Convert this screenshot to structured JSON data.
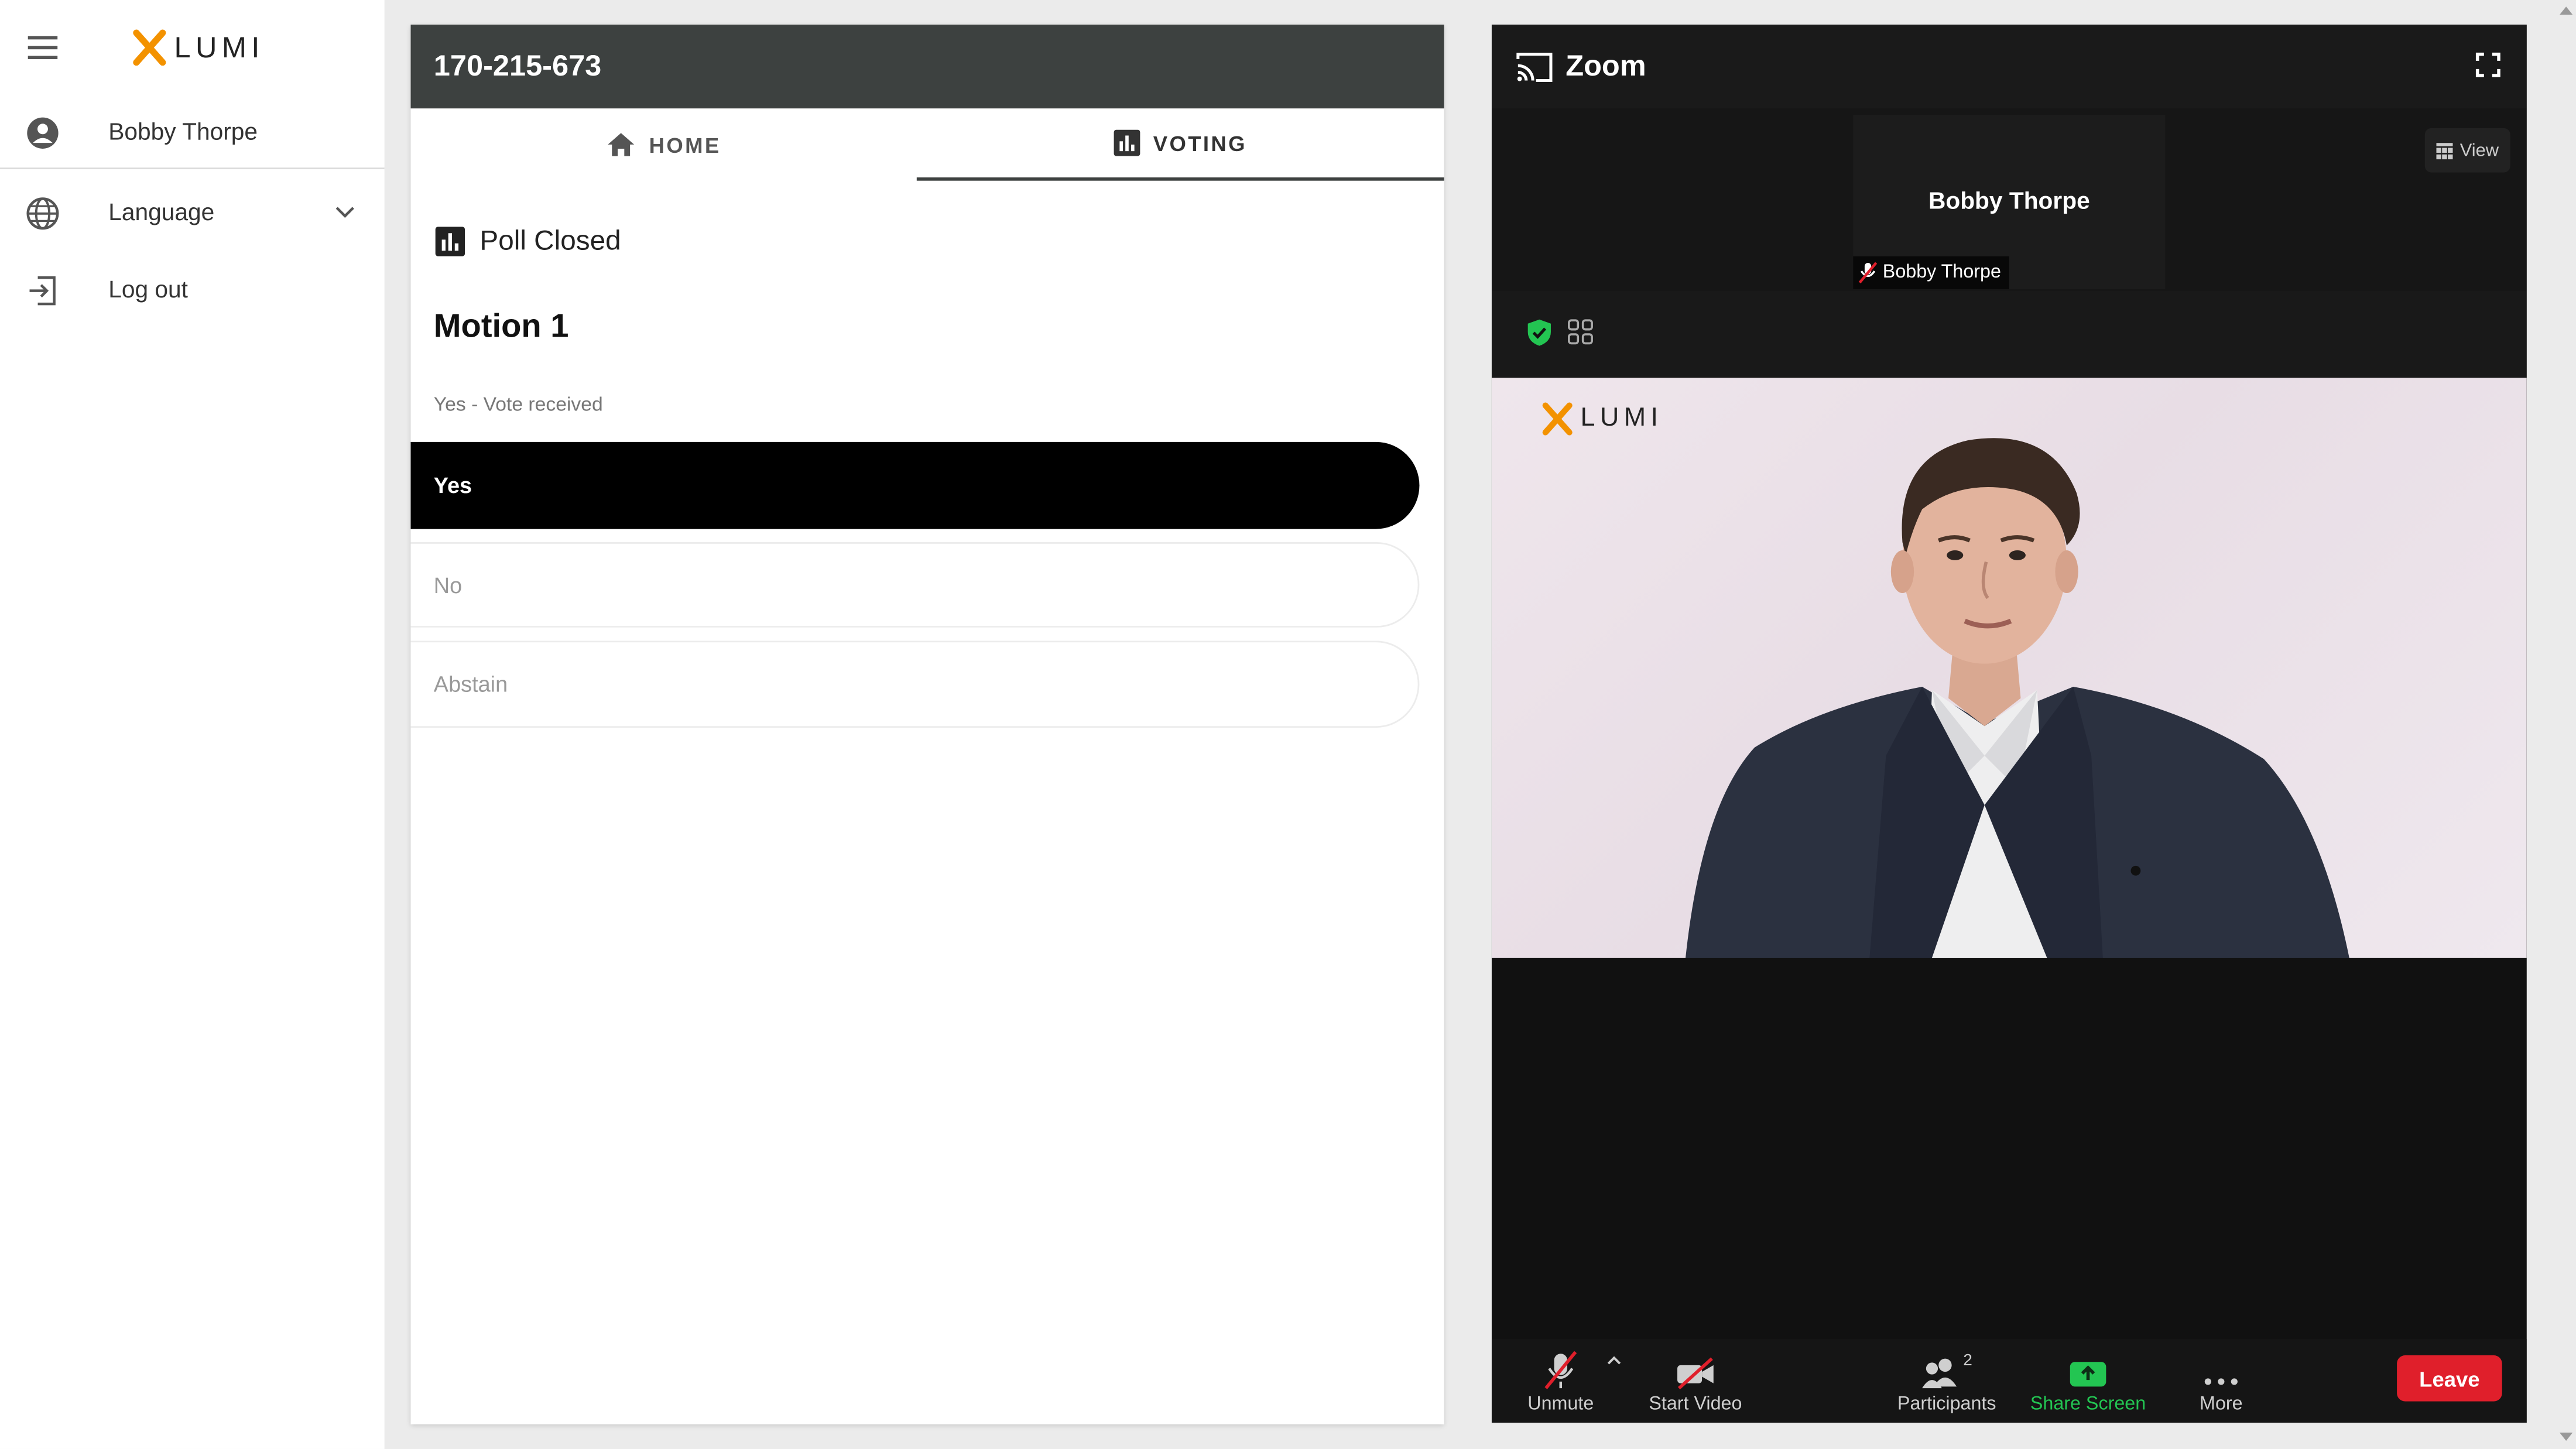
{
  "sidebar": {
    "logo_text": "LUMI",
    "user_name": "Bobby Thorpe",
    "language_label": "Language",
    "logout_label": "Log out"
  },
  "voting": {
    "meeting_id": "170-215-673",
    "tabs": [
      {
        "label": "HOME",
        "icon": "home-icon"
      },
      {
        "label": "VOTING",
        "icon": "bar-chart-icon",
        "active": true
      }
    ],
    "poll_status": "Poll Closed",
    "motion_title": "Motion 1",
    "vote_status": "Yes - Vote received",
    "options": [
      {
        "label": "Yes",
        "selected": true
      },
      {
        "label": "No",
        "selected": false
      },
      {
        "label": "Abstain",
        "selected": false
      }
    ]
  },
  "zoom": {
    "title": "Zoom",
    "view_label": "View",
    "thumbnail_name": "Bobby Thorpe",
    "thumbnail_tag": "Bobby Thorpe",
    "video_logo_text": "LUMI",
    "toolbar": {
      "unmute": "Unmute",
      "start_video": "Start Video",
      "participants": "Participants",
      "participants_count": "2",
      "share_screen": "Share Screen",
      "more": "More",
      "leave": "Leave"
    }
  },
  "colors": {
    "accent_orange": "#f39200",
    "header_dark": "#3d4140",
    "selected_option": "#000000",
    "leave_red": "#e01f2b",
    "share_green": "#23c552"
  }
}
